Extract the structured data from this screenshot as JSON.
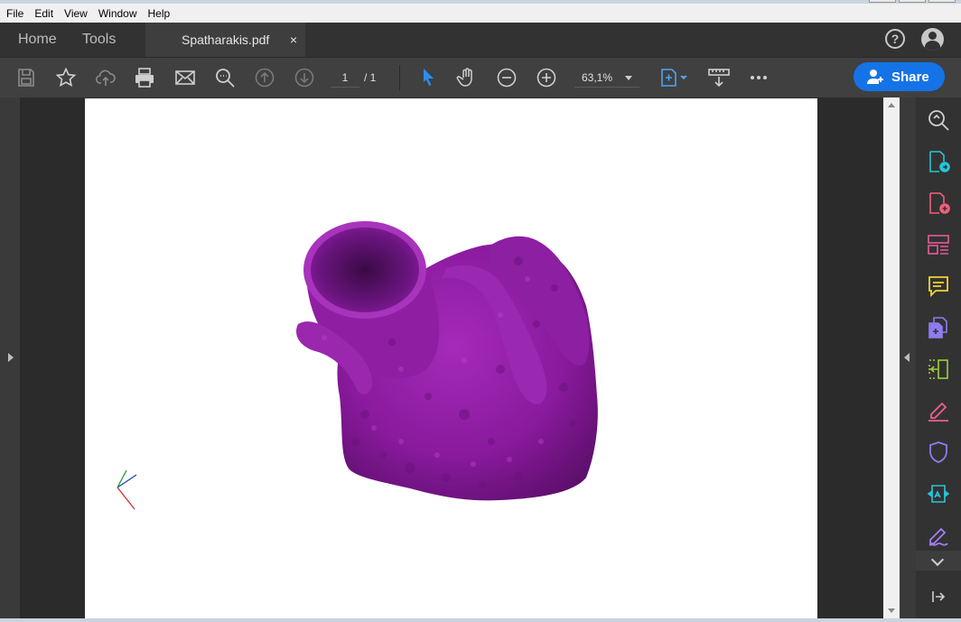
{
  "menu": [
    "File",
    "Edit",
    "View",
    "Window",
    "Help"
  ],
  "tabs": {
    "home": "Home",
    "tools": "Tools",
    "document": "Spatharakis.pdf",
    "close": "×"
  },
  "header": {
    "help": "?"
  },
  "toolbar": {
    "page_current": "1",
    "page_total": "/ 1",
    "zoom": "63,1%",
    "share_label": "Share"
  },
  "icons": {
    "save": "save-icon",
    "bookmark": "star-icon",
    "upload": "cloud-upload-icon",
    "print": "printer-icon",
    "email": "envelope-icon",
    "find": "search-icon",
    "prev": "arrow-up-circle-icon",
    "next": "arrow-down-circle-icon",
    "select": "cursor-icon",
    "hand": "hand-icon",
    "zoom_out": "zoom-out-icon",
    "zoom_in": "zoom-in-icon",
    "fit": "fit-page-icon",
    "scroll": "scroll-mode-icon",
    "more": "more-icon"
  },
  "right_rail": [
    {
      "name": "zoom-tool-icon",
      "color": "#cfcfcf"
    },
    {
      "name": "export-pdf-icon",
      "color": "#27c4d6"
    },
    {
      "name": "create-pdf-icon",
      "color": "#ef5f7a"
    },
    {
      "name": "organize-pages-icon",
      "color": "#e75a9a"
    },
    {
      "name": "comment-icon",
      "color": "#f3d134"
    },
    {
      "name": "combine-files-icon",
      "color": "#8e7bef"
    },
    {
      "name": "edit-pdf-icon",
      "color": "#9bd136"
    },
    {
      "name": "fill-sign-icon",
      "color": "#ec5f95"
    },
    {
      "name": "protect-icon",
      "color": "#8e7bef"
    },
    {
      "name": "send-for-review-icon",
      "color": "#27c4d6"
    },
    {
      "name": "request-signature-icon",
      "color": "#a37ef0"
    }
  ],
  "colors": {
    "model": "#8f1ea3",
    "accent": "#1473e6"
  }
}
